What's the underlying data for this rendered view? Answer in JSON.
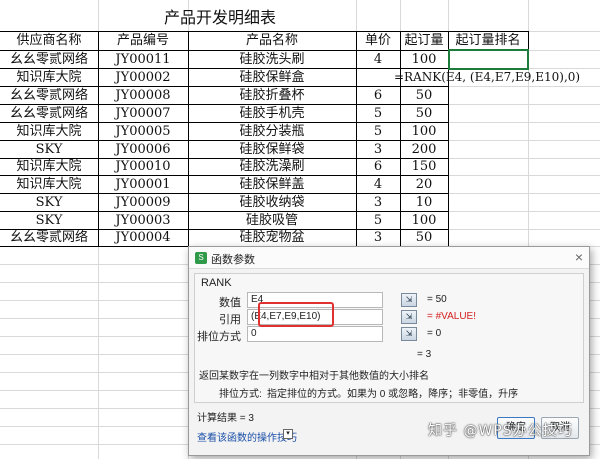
{
  "sheet": {
    "title": "产品开发明细表",
    "headers": [
      "供应商名称",
      "产品编号",
      "产品名称",
      "单价",
      "起订量",
      "起订量排名"
    ],
    "rows": [
      [
        "幺幺零贰网络",
        "JY00011",
        "硅胶洗头刷",
        "4",
        "100"
      ],
      [
        "知识库大院",
        "JY00002",
        "硅胶保鲜盒",
        "",
        ""
      ],
      [
        "幺幺零贰网络",
        "JY00008",
        "硅胶折叠杯",
        "6",
        "50"
      ],
      [
        "幺幺零贰网络",
        "JY00007",
        "硅胶手机壳",
        "5",
        "50"
      ],
      [
        "知识库大院",
        "JY00005",
        "硅胶分装瓶",
        "5",
        "100"
      ],
      [
        "SKY",
        "JY00006",
        "硅胶保鲜袋",
        "3",
        "200"
      ],
      [
        "知识库大院",
        "JY00010",
        "硅胶洗澡刷",
        "6",
        "150"
      ],
      [
        "知识库大院",
        "JY00001",
        "硅胶保鲜盖",
        "4",
        "20"
      ],
      [
        "SKY",
        "JY00009",
        "硅胶收纳袋",
        "3",
        "10"
      ],
      [
        "SKY",
        "JY00003",
        "硅胶吸管",
        "5",
        "100"
      ],
      [
        "幺幺零贰网络",
        "JY00004",
        "硅胶宠物盆",
        "3",
        "50"
      ]
    ],
    "formula_text": "=RANK(E4, (E4,E7,E9,E10),0)"
  },
  "dialog": {
    "title": "函数参数",
    "close": "×",
    "function_name": "RANK",
    "params": [
      {
        "label": "数值",
        "value": "E4",
        "result": "= 50"
      },
      {
        "label": "引用",
        "value": "(E4,E7,E9,E10)",
        "result": "= #VALUE!"
      },
      {
        "label": "排位方式",
        "value": "0",
        "result": "= 0"
      }
    ],
    "overall_result": "= 3",
    "description": "返回某数字在一列数字中相对于其他数值的大小排名",
    "param_desc_label": "排位方式:",
    "param_desc": "指定排位的方式。如果为 0 或忽略，降序；非零值，升序",
    "calc_result": "计算结果 = 3",
    "help_link": "查看该函数的操作技巧",
    "help_icon": "▾",
    "ok_label": "确定",
    "cancel_label": "取消",
    "ref_icon": "⇲"
  },
  "watermark": "知乎 @WPS办公技巧",
  "colors": {
    "selection": "#1e7c3a",
    "error": "#d42020",
    "ok_border": "#3b78c4"
  }
}
